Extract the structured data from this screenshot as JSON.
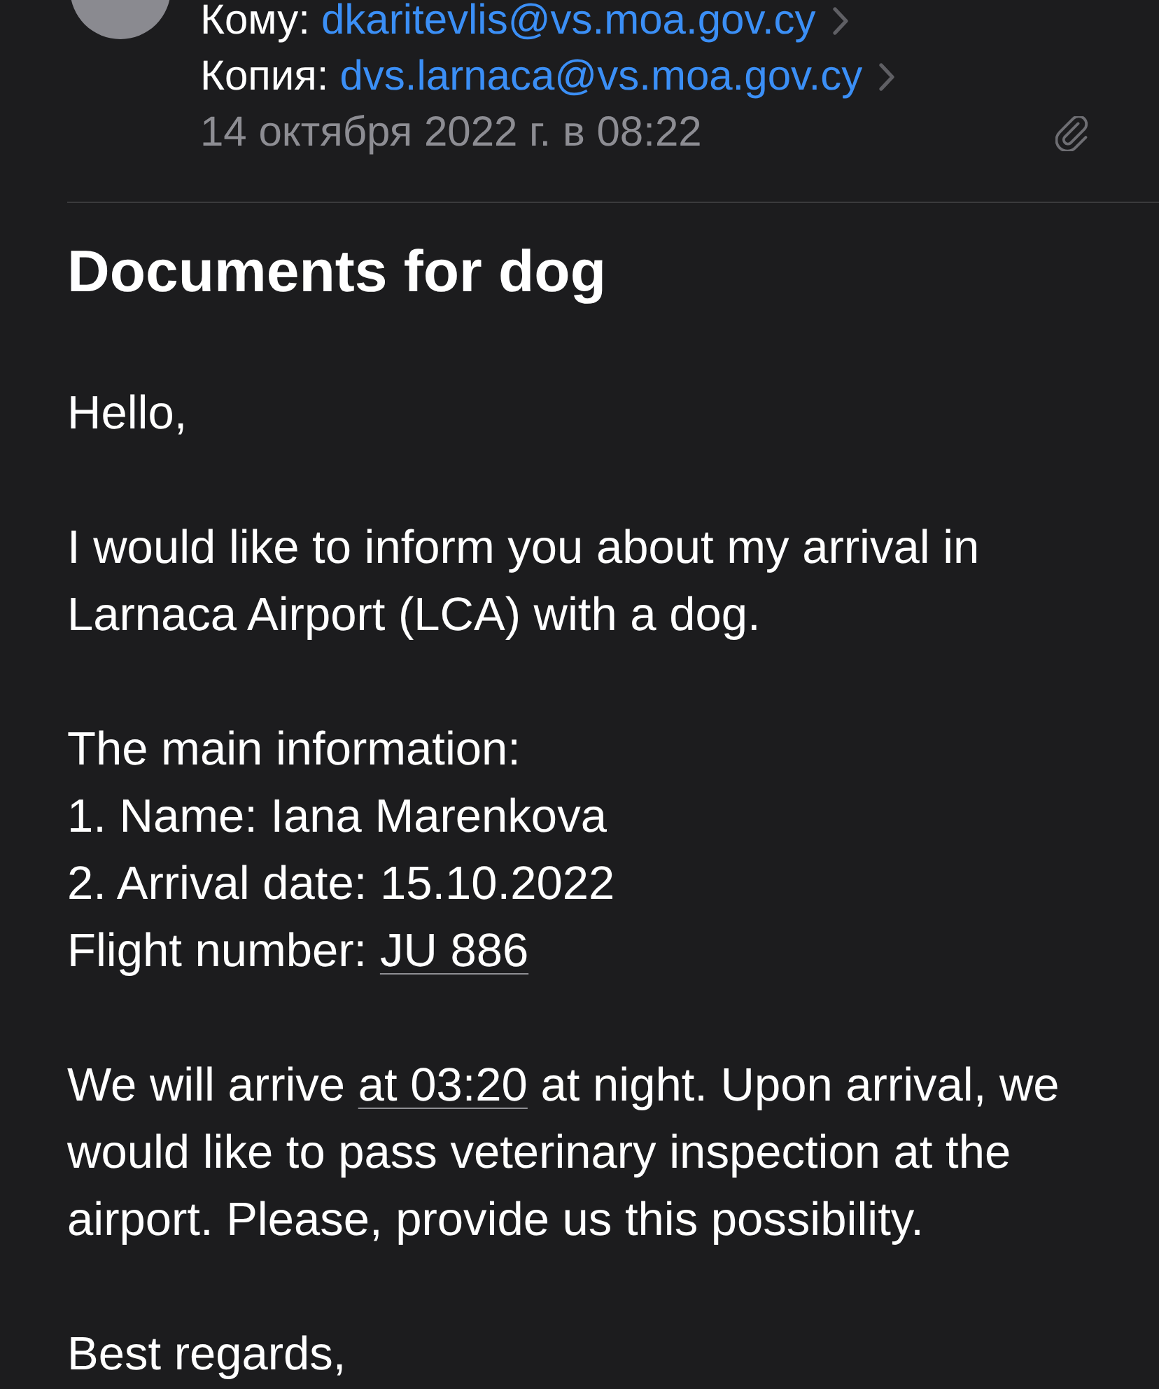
{
  "header": {
    "recipients": [
      {
        "label": "Кому:",
        "address": "dkaritevlis@vs.moa.gov.cy"
      },
      {
        "label": "Копия:",
        "address": "dvs.larnaca@vs.moa.gov.cy"
      }
    ],
    "date": "14 октября 2022 г. в 08:22",
    "has_attachment": true
  },
  "subject": "Documents for dog",
  "body": [
    {
      "lines": [
        [
          {
            "kind": "text",
            "text": "Hello,"
          }
        ]
      ]
    },
    {
      "lines": [
        [
          {
            "kind": "text",
            "text": "I would like to inform you about my arrival in Larnaca Airport (LCA) with a dog."
          }
        ]
      ]
    },
    {
      "lines": [
        [
          {
            "kind": "text",
            "text": "The main information:"
          }
        ],
        [
          {
            "kind": "text",
            "text": "1. Name: Iana Marenkova"
          }
        ],
        [
          {
            "kind": "text",
            "text": "2. Arrival date: 15.10.2022"
          }
        ],
        [
          {
            "kind": "text",
            "text": "Flight number: "
          },
          {
            "kind": "detected",
            "text": "JU 886"
          }
        ]
      ]
    },
    {
      "lines": [
        [
          {
            "kind": "text",
            "text": "We will arrive "
          },
          {
            "kind": "detected",
            "text": "at 03:20"
          },
          {
            "kind": "text",
            "text": " at night. Upon arrival, we would like to pass veterinary inspection at the airport. Please, provide us this possibility."
          }
        ]
      ]
    },
    {
      "lines": [
        [
          {
            "kind": "text",
            "text": "Best regards,"
          }
        ]
      ]
    }
  ]
}
